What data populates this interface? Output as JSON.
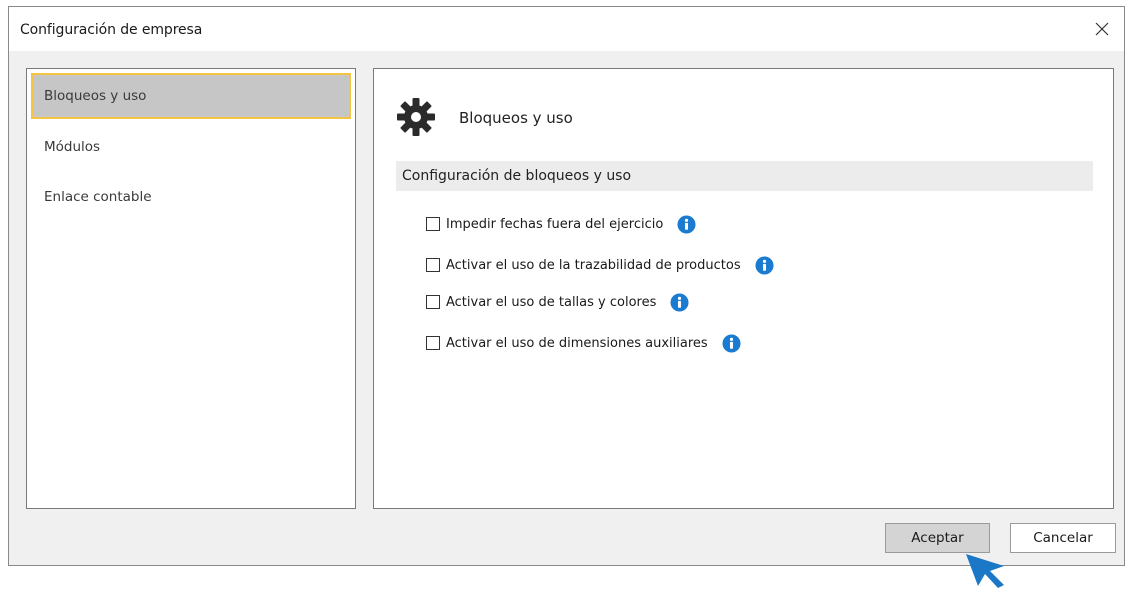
{
  "window": {
    "title": "Configuración de empresa"
  },
  "sidebar": {
    "items": [
      {
        "label": "Bloqueos y uso",
        "active": true
      },
      {
        "label": "Módulos",
        "active": false
      },
      {
        "label": "Enlace contable",
        "active": false
      }
    ]
  },
  "main": {
    "section_title": "Bloqueos y uso",
    "section_icon": "gear-icon",
    "group_header": "Configuración de bloqueos y uso",
    "options": [
      {
        "label": "Impedir fechas fuera del ejercicio",
        "checked": false
      },
      {
        "label": "Activar el uso de la trazabilidad de productos",
        "checked": false
      },
      {
        "label": "Activar el uso de tallas y colores",
        "checked": false
      },
      {
        "label": "Activar el uso de dimensiones auxiliares",
        "checked": false
      }
    ]
  },
  "footer": {
    "accept_label": "Aceptar",
    "cancel_label": "Cancelar"
  },
  "colors": {
    "accent_info": "#1b7bd0",
    "active_border": "#f4c542",
    "cursor": "#1b78c6"
  }
}
